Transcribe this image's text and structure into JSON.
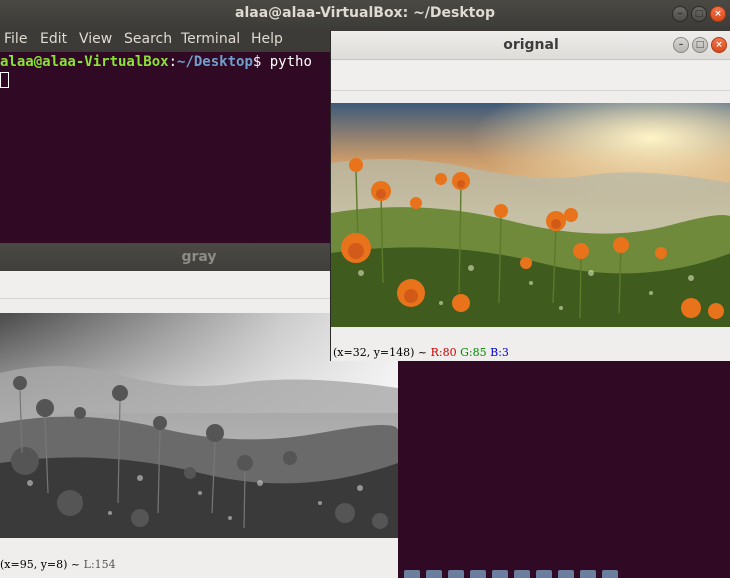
{
  "terminal": {
    "title": "alaa@alaa-VirtualBox: ~/Desktop",
    "menu": [
      "File",
      "Edit",
      "View",
      "Search",
      "Terminal",
      "Help"
    ],
    "prompt_user": "alaa@alaa-VirtualBox",
    "prompt_sep": ":",
    "prompt_path": "~/Desktop",
    "prompt_symbol": "$ ",
    "command": "pytho",
    "colors": {
      "background": "#300a24",
      "user": "#8ae234",
      "path": "#729fcf"
    }
  },
  "gray_window": {
    "title": "gray",
    "status": {
      "coords": "(x=95, y=8) ~ ",
      "luminance": "L:154"
    }
  },
  "original_window": {
    "title": "orignal",
    "status": {
      "coords": "(x=32, y=148) ~ ",
      "r": "R:80",
      "g": "G:85",
      "b": "B:3"
    }
  },
  "icons": [
    "minimize-icon",
    "maximize-icon",
    "close-icon",
    "terminal-cursor-icon"
  ]
}
